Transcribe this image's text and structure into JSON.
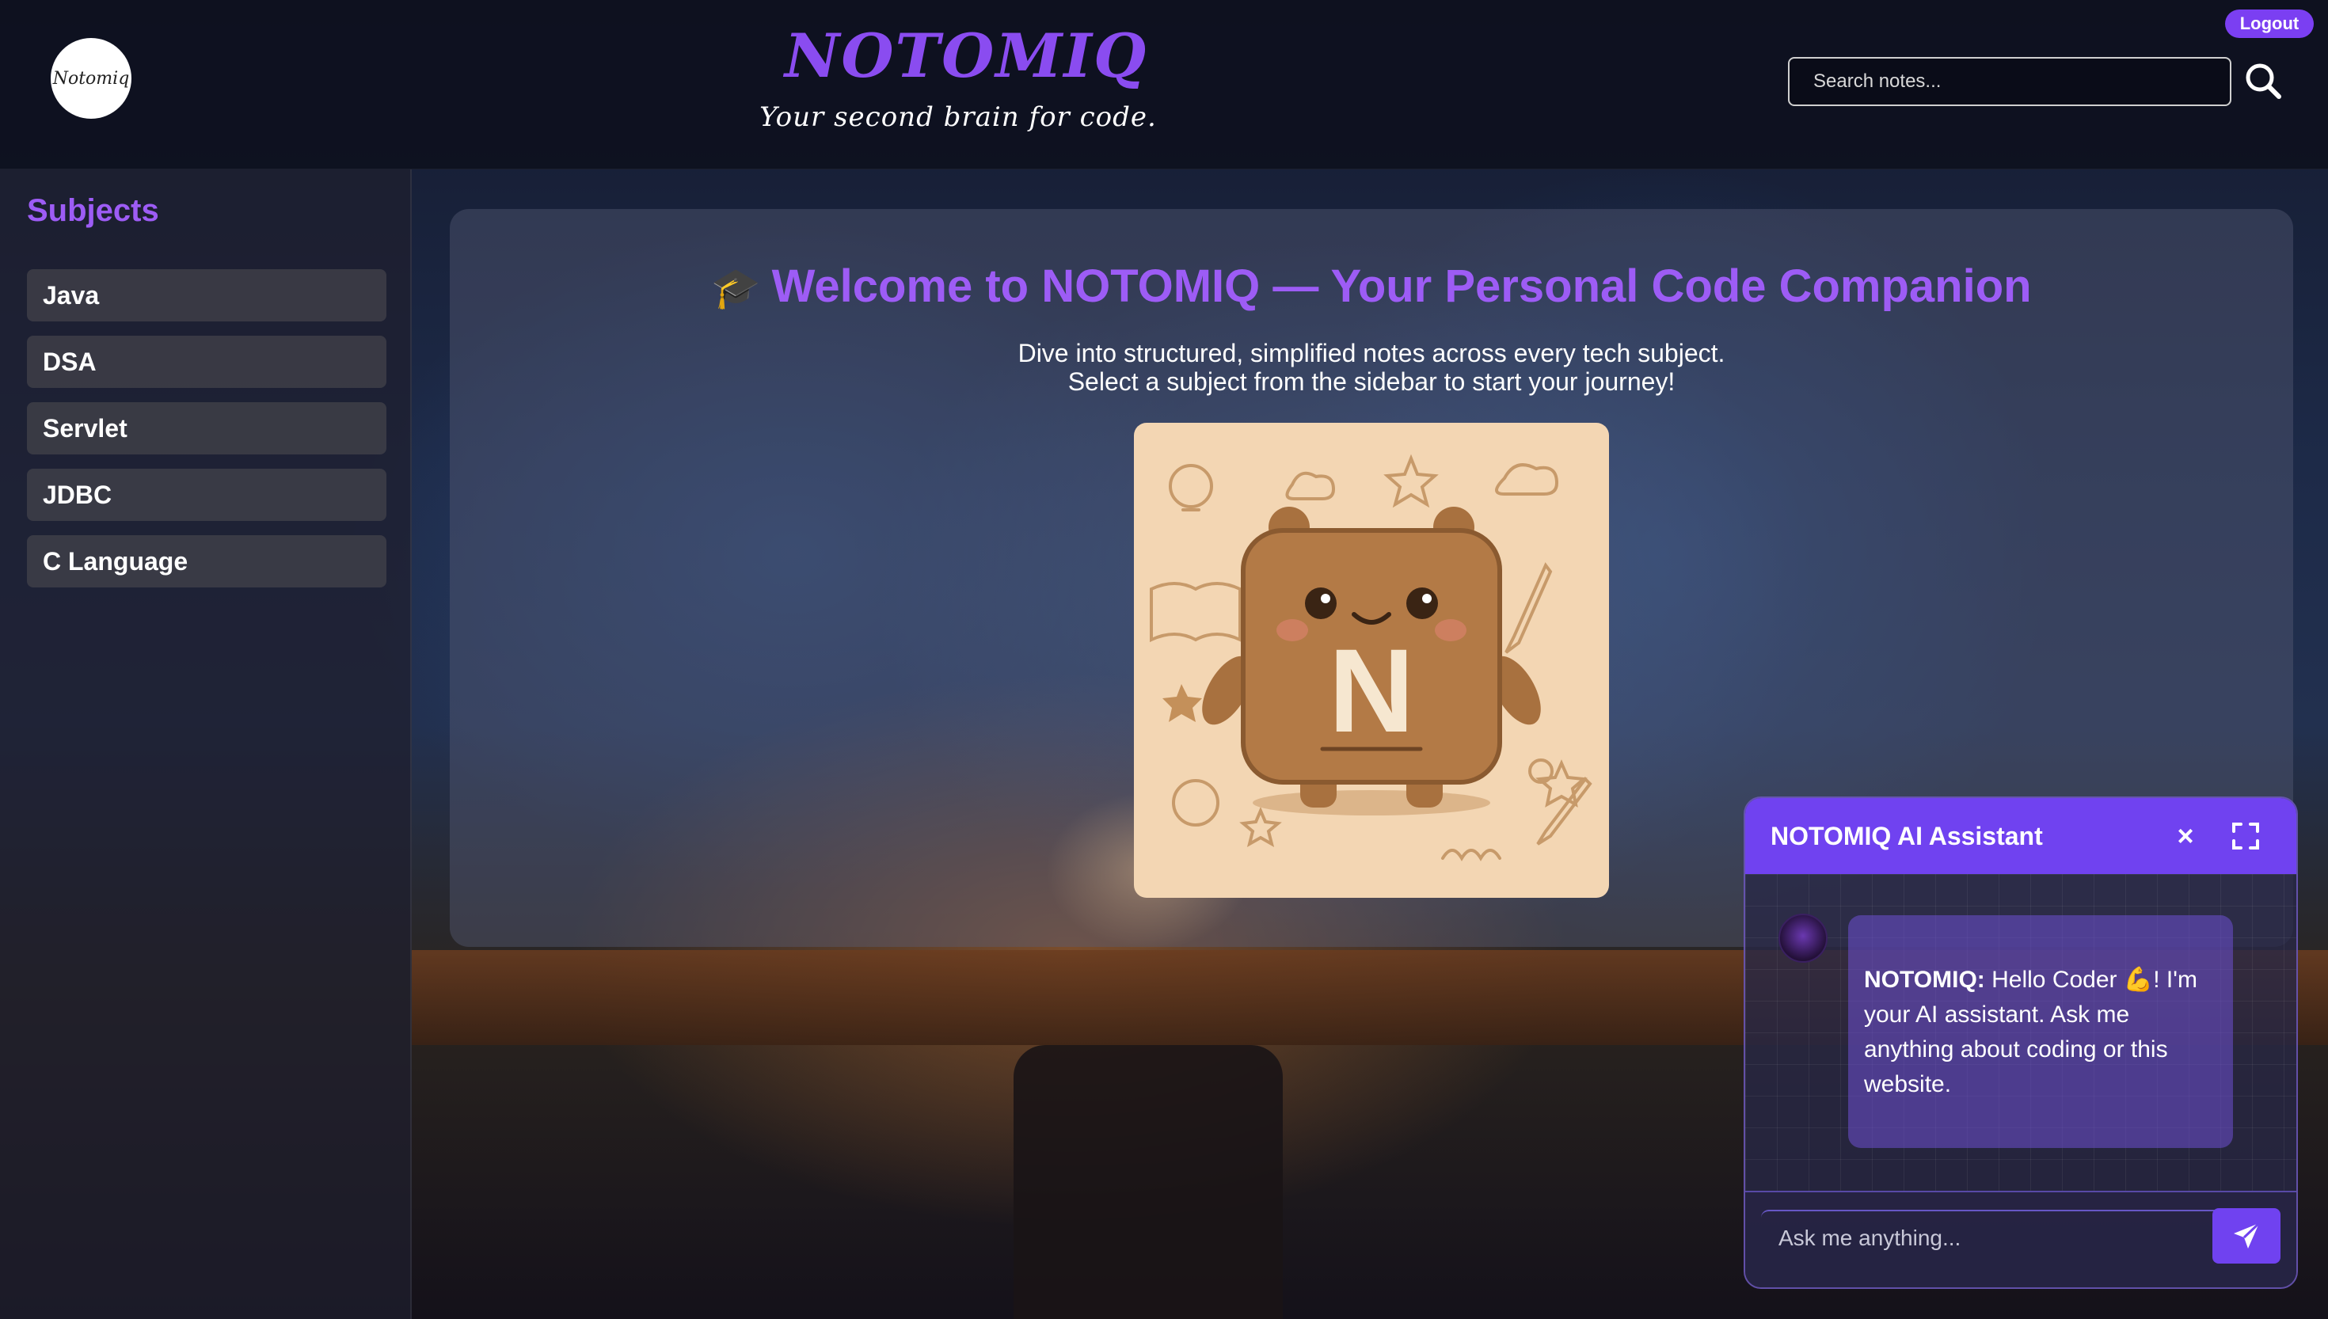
{
  "header": {
    "logo_text": "Notomiq",
    "brand": "NOTOMIQ",
    "tagline": "Your second brain for code.",
    "search_placeholder": "Search notes...",
    "logout_label": "Logout"
  },
  "sidebar": {
    "title": "Subjects",
    "items": [
      {
        "label": "Java"
      },
      {
        "label": "DSA"
      },
      {
        "label": "Servlet"
      },
      {
        "label": "JDBC"
      },
      {
        "label": "C Language"
      }
    ]
  },
  "welcome": {
    "icon": "🎓",
    "title": "Welcome to NOTOMIQ — Your Personal Code Companion",
    "line1": "Dive into structured, simplified notes across every tech subject.",
    "line2": "Select a subject from the sidebar to start your journey!",
    "mascot_letter": "N"
  },
  "chat": {
    "title": "NOTOMIQ AI Assistant",
    "close_glyph": "×",
    "message_sender": "NOTOMIQ:",
    "message_text": " Hello Coder 💪! I'm your AI assistant. Ask me anything about coding or this website.",
    "input_placeholder": "Ask me anything..."
  },
  "colors": {
    "accent": "#8a4cf0",
    "chat_header": "#7042f0",
    "sidebar_item": "#3e3e48"
  }
}
